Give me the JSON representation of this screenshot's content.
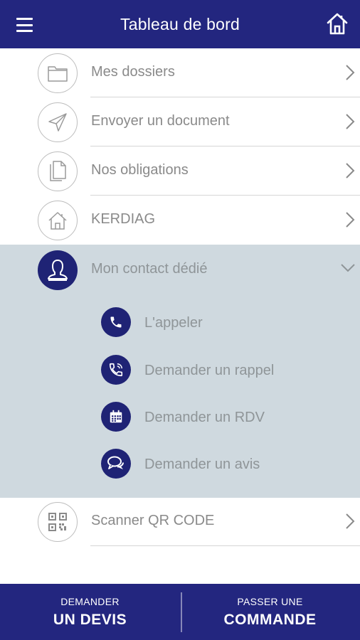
{
  "header": {
    "title": "Tableau de bord",
    "menu_icon": "hamburger-icon",
    "home_icon": "home-icon",
    "background": "#23267f"
  },
  "menu": {
    "items": [
      {
        "label": "Mes dossiers",
        "icon": "folder-icon"
      },
      {
        "label": "Envoyer un document",
        "icon": "send-icon"
      },
      {
        "label": "Nos obligations",
        "icon": "documents-icon"
      },
      {
        "label": "KERDIAG",
        "icon": "house-icon"
      }
    ]
  },
  "contact": {
    "label": "Mon contact dédié",
    "icon": "user-icon",
    "expanded": true,
    "background": "#cfd9df",
    "actions": [
      {
        "label": "L'appeler",
        "icon": "phone-icon"
      },
      {
        "label": "Demander un rappel",
        "icon": "callback-icon"
      },
      {
        "label": "Demander un RDV",
        "icon": "calendar-icon"
      },
      {
        "label": "Demander un avis",
        "icon": "chat-icon"
      }
    ]
  },
  "scanner": {
    "label": "Scanner QR CODE",
    "icon": "qr-code-icon"
  },
  "footer": {
    "quote": {
      "small": "DEMANDER",
      "big": "UN DEVIS"
    },
    "order": {
      "small": "PASSER UNE",
      "big": "COMMANDE"
    }
  }
}
